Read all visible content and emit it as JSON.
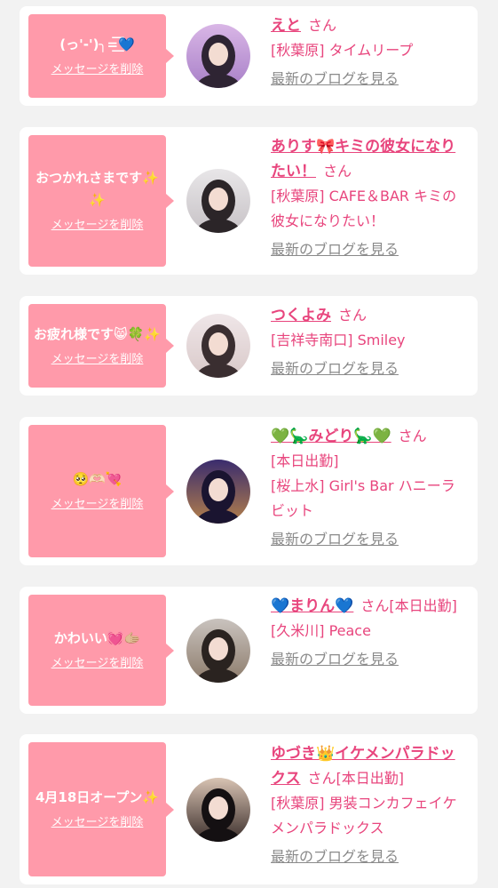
{
  "colors": {
    "page_bg": "#f2f2f2",
    "card_bg": "#ffffff",
    "bubble_bg": "#ff9aaa",
    "accent_text": "#e8457d",
    "muted_link": "#8a8a8a"
  },
  "delete_label": "メッセージを削除",
  "blog_link_label": "最新のブログを見る",
  "cards": [
    {
      "message": "(っ'-')╮=͟͟͞͞💙",
      "name": "えと",
      "honorific": "さん",
      "shop_lines": [
        "[秋葉原] タイムリープ"
      ],
      "avatar_colors": [
        "#d9b6e6",
        "#a880c8",
        "#2e2433"
      ]
    },
    {
      "message": "おつかれさまです✨✨",
      "name": "ありす🎀キミの彼女になりたい！",
      "honorific": "さん",
      "shop_lines": [
        "[秋葉原] CAFE＆BAR キミの彼女になりたい！"
      ],
      "avatar_colors": [
        "#e8e6e8",
        "#c7c2c6",
        "#2b2528"
      ]
    },
    {
      "message": "お疲れ様です😸🍀✨",
      "name": "つくよみ",
      "honorific": "さん",
      "shop_lines": [
        "[吉祥寺南口] Smiley"
      ],
      "avatar_colors": [
        "#efe6e8",
        "#d9c9c9",
        "#3a2e30"
      ]
    },
    {
      "message": "🥺🫶🏻💘",
      "name": "💚🦕みどり🦕💚",
      "honorific": "さん",
      "shop_lines": [
        "[本日出勤]",
        "[桜上水] Girl's Bar ハニーラビット"
      ],
      "avatar_colors": [
        "#3a2c6e",
        "#b5804a",
        "#1a1430"
      ]
    },
    {
      "message": "かわいい💓🫱🏼",
      "name": "💙まりん💙",
      "honorific": "さん[本日出勤]",
      "shop_lines": [
        "[久米川] Peace"
      ],
      "avatar_colors": [
        "#c9c3be",
        "#8c7a6a",
        "#2a2320"
      ]
    },
    {
      "message": "4月18日オープン✨",
      "name": "ゆづき👑イケメンパラドックス",
      "honorific": "さん[本日出勤]",
      "shop_lines": [
        "[秋葉原] 男装コンカフェイケメンパラドックス"
      ],
      "avatar_colors": [
        "#d8c3b3",
        "#3a2d2a",
        "#141012"
      ]
    }
  ]
}
